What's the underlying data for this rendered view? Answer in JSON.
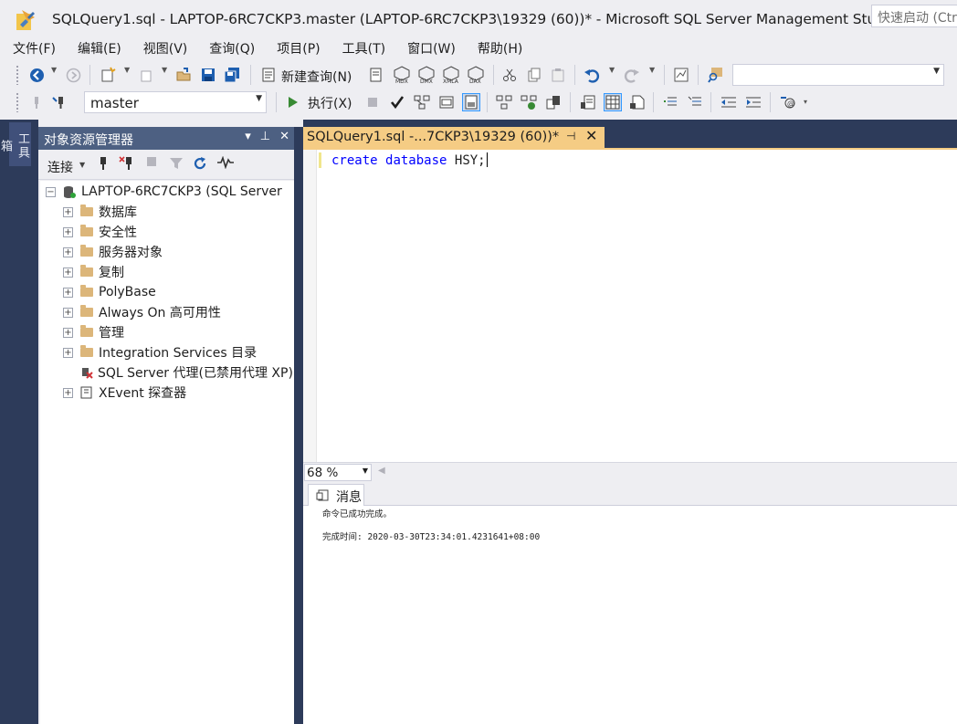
{
  "window": {
    "title": "SQLQuery1.sql - LAPTOP-6RC7CKP3.master (LAPTOP-6RC7CKP3\\19329 (60))* - Microsoft SQL Server Management Studio",
    "quick_launch_placeholder": "快速启动 (Ctrl+Q)"
  },
  "menu": [
    "文件(F)",
    "编辑(E)",
    "视图(V)",
    "查询(Q)",
    "项目(P)",
    "工具(T)",
    "窗口(W)",
    "帮助(H)"
  ],
  "toolbar": {
    "new_query_label": "新建查询(N)",
    "execute_label": "执行(X)",
    "database_selected": "master",
    "solution_config_value": ""
  },
  "left_tool_tab": "工具箱",
  "object_explorer": {
    "title": "对象资源管理器",
    "connect_label": "连接",
    "server_node": "LAPTOP-6RC7CKP3 (SQL Server",
    "nodes": [
      "数据库",
      "安全性",
      "服务器对象",
      "复制",
      "PolyBase",
      "Always On 高可用性",
      "管理",
      "Integration Services 目录",
      "SQL Server 代理(已禁用代理 XP)",
      "XEvent 探查器"
    ]
  },
  "document_tab": {
    "title": "SQLQuery1.sql -...7CKP3\\19329 (60))*"
  },
  "editor": {
    "kw_create": "create",
    "kw_database": "database",
    "identifier": "HSY;"
  },
  "zoom": "68 %",
  "results": {
    "tab_label": "消息",
    "messages": [
      "命令已成功完成。",
      "完成时间: 2020-03-30T23:34:01.4231641+08:00"
    ]
  },
  "colors": {
    "accent_tab": "#f5cc84",
    "panel_dark": "#2d3b5a",
    "oe_header": "#4d6082",
    "keyword": "#0000ff"
  }
}
